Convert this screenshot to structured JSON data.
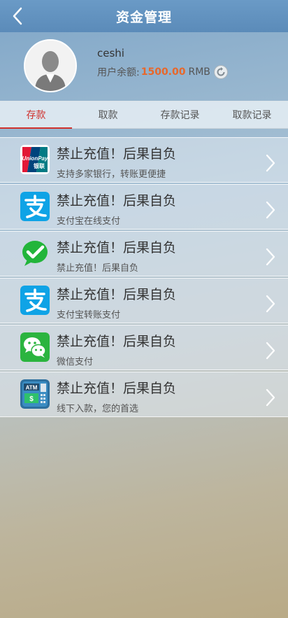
{
  "header": {
    "title": "资金管理"
  },
  "profile": {
    "username": "ceshi",
    "balance_label": "用户余额:",
    "balance_value": "1500.00",
    "balance_unit": "RMB"
  },
  "tabs": [
    {
      "label": "存款",
      "active": true
    },
    {
      "label": "取款",
      "active": false
    },
    {
      "label": "存款记录",
      "active": false
    },
    {
      "label": "取款记录",
      "active": false
    }
  ],
  "payment_methods": [
    {
      "icon": "unionpay-icon",
      "icon_text_top": "UnionPay",
      "icon_text_bottom": "银联",
      "title": "禁止充值！后果自负",
      "subtitle": "支持多家银行，转账更便捷"
    },
    {
      "icon": "alipay-icon",
      "title": "禁止充值！后果自负",
      "subtitle": "支付宝在线支付"
    },
    {
      "icon": "wechat-check-icon",
      "title": "禁止充值！后果自负",
      "subtitle": "禁止充值！后果自负"
    },
    {
      "icon": "alipay-icon",
      "title": "禁止充值！后果自负",
      "subtitle": "支付宝转账支付"
    },
    {
      "icon": "wechat-icon",
      "title": "禁止充值！后果自负",
      "subtitle": "微信支付"
    },
    {
      "icon": "atm-icon",
      "icon_text_top": "ATM",
      "title": "禁止充值！后果自负",
      "subtitle": "线下入款，您的首选"
    }
  ],
  "colors": {
    "accent_red": "#d0312d",
    "balance_orange": "#e8672a",
    "header_blue": "#6a9ac6"
  }
}
